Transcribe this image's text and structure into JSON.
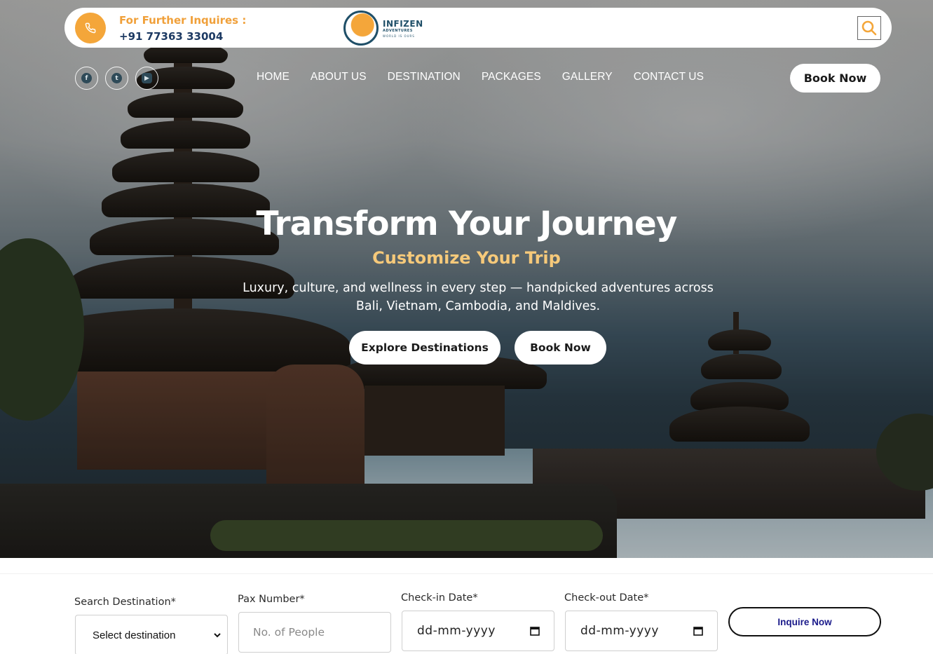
{
  "topbar": {
    "inquiry_label": "For Further Inquires :",
    "phone": "+91 77363 33004",
    "phone_icon": "phone-icon",
    "search_icon": "search-icon",
    "accent_color": "#f4a63a"
  },
  "logo": {
    "name": "INFIZEN",
    "sub": "ADVENTURES",
    "tagline": "WORLD IS OURS"
  },
  "socials": [
    "facebook-icon",
    "twitter-icon",
    "youtube-icon"
  ],
  "nav": {
    "items": [
      {
        "label": "HOME"
      },
      {
        "label": "ABOUT US"
      },
      {
        "label": "DESTINATION"
      },
      {
        "label": "PACKAGES"
      },
      {
        "label": "GALLERY"
      },
      {
        "label": "CONTACT US"
      }
    ],
    "book_label": "Book Now"
  },
  "hero": {
    "title": "Transform Your Journey",
    "subtitle": "Customize Your Trip",
    "description": "Luxury, culture, and wellness in every step — handpicked adventures across Bali, Vietnam, Cambodia, and Maldives.",
    "explore_label": "Explore Destinations",
    "book_label": "Book Now",
    "subtitle_color": "#f6c97a"
  },
  "form": {
    "destination": {
      "label": "Search Destination*",
      "selected": "Select destination"
    },
    "pax": {
      "label": "Pax Number*",
      "placeholder": "No. of People"
    },
    "checkin": {
      "label": "Check-in Date*",
      "value": "dd-mm-yyyy"
    },
    "checkout": {
      "label": "Check-out Date*",
      "value": "dd-mm-yyyy"
    },
    "submit_label": "Inquire Now"
  }
}
